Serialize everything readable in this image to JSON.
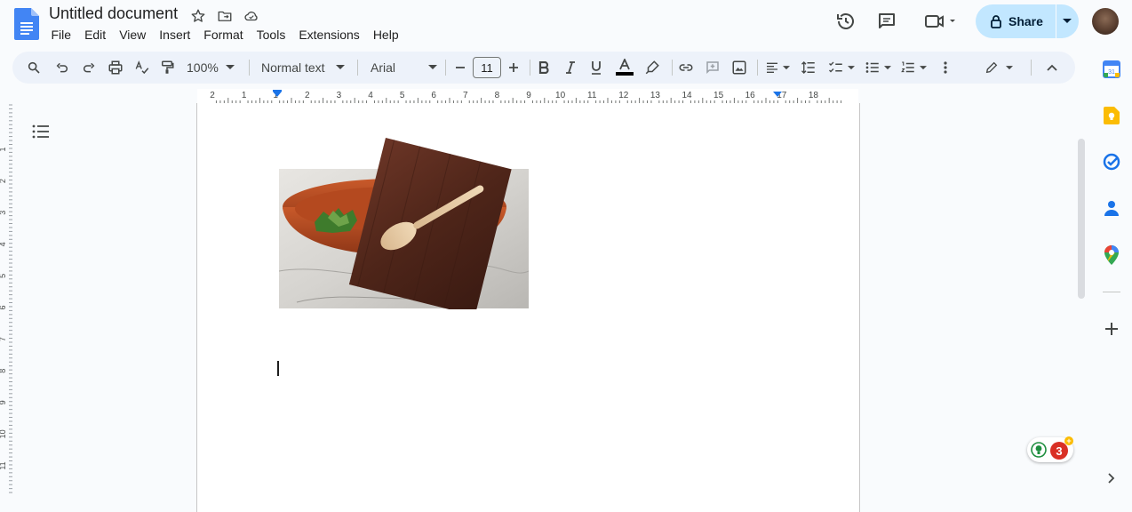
{
  "document": {
    "title": "Untitled document"
  },
  "menu": {
    "items": [
      "File",
      "Edit",
      "View",
      "Insert",
      "Format",
      "Tools",
      "Extensions",
      "Help"
    ]
  },
  "share": {
    "label": "Share"
  },
  "toolbar": {
    "zoom": "100%",
    "style": "Normal text",
    "font": "Arial",
    "font_size": "11"
  },
  "ruler": {
    "labels": [
      "2",
      "1",
      "1",
      "2",
      "3",
      "4",
      "5",
      "6",
      "7",
      "8",
      "9",
      "10",
      "11",
      "12",
      "13",
      "14",
      "15",
      "16",
      "17",
      "18"
    ],
    "left_labels": [
      "1",
      "2",
      "3",
      "4",
      "5",
      "6",
      "7",
      "8",
      "9",
      "10",
      "11"
    ]
  },
  "side_panel": {
    "calendar_day": "31"
  },
  "badge": {
    "count": "3"
  },
  "colors": {
    "accent": "#0b57d0",
    "share_bg": "#c2e7ff",
    "toolbar_bg": "#edf2fa",
    "doc_blue": "#4285f4"
  },
  "image": {
    "description_icon": "salad-bowl-with-spoon-on-board-image"
  }
}
